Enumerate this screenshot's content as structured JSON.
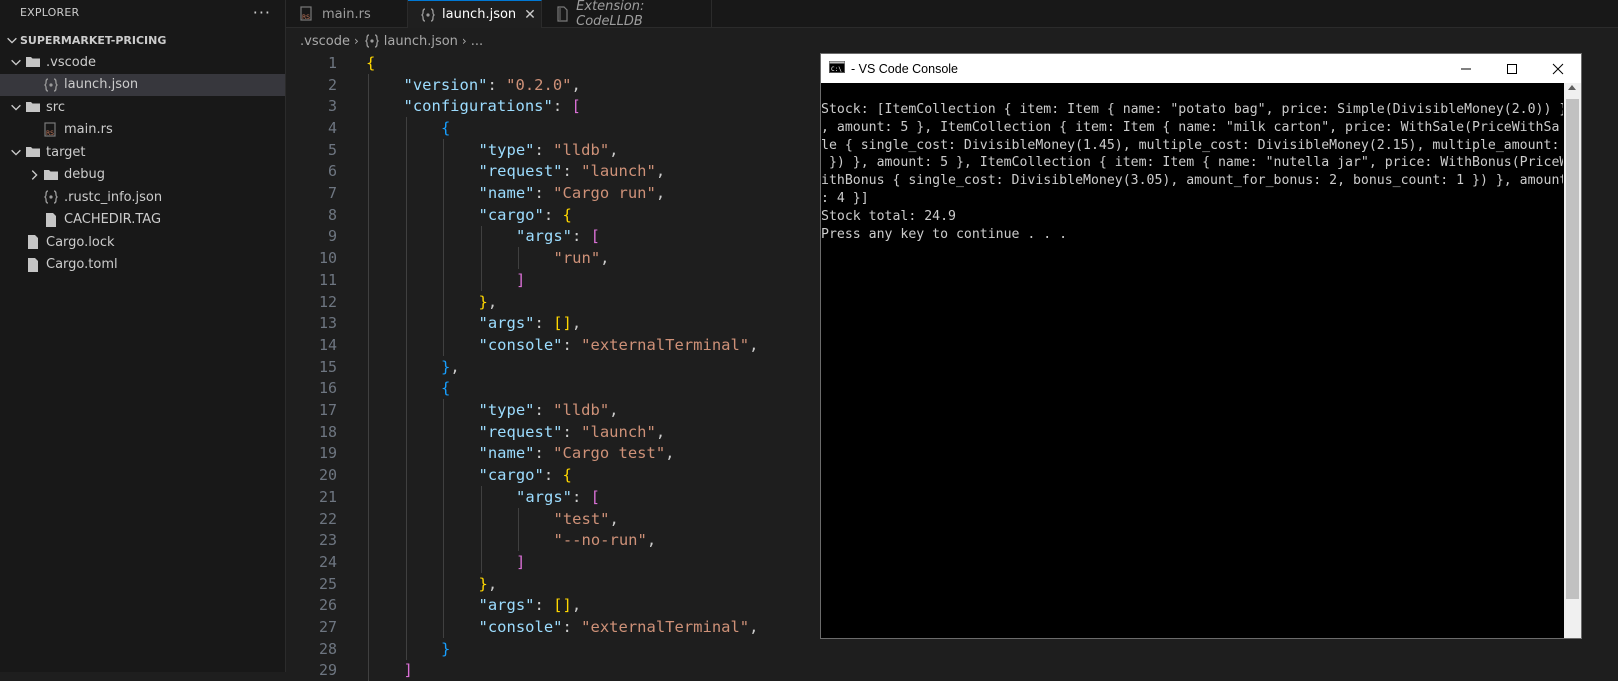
{
  "explorer": {
    "title": "EXPLORER",
    "more_glyph": "···",
    "root": "SUPERMARKET-PRICING",
    "items": [
      {
        "label": ".vscode",
        "kind": "folder",
        "open": true,
        "depth": 1
      },
      {
        "label": "launch.json",
        "kind": "json",
        "depth": 2,
        "selected": true
      },
      {
        "label": "src",
        "kind": "folder",
        "open": true,
        "depth": 1
      },
      {
        "label": "main.rs",
        "kind": "rust",
        "depth": 2
      },
      {
        "label": "target",
        "kind": "folder",
        "open": true,
        "depth": 1
      },
      {
        "label": "debug",
        "kind": "folder",
        "open": false,
        "depth": 2
      },
      {
        "label": ".rustc_info.json",
        "kind": "json",
        "depth": 2
      },
      {
        "label": "CACHEDIR.TAG",
        "kind": "file",
        "depth": 2
      },
      {
        "label": "Cargo.lock",
        "kind": "file",
        "depth": 1
      },
      {
        "label": "Cargo.toml",
        "kind": "file",
        "depth": 1
      }
    ]
  },
  "tabs": [
    {
      "label": "main.rs",
      "icon": "rust-file-icon"
    },
    {
      "label": "launch.json",
      "icon": "json-file-icon",
      "active": true,
      "close": "✕"
    },
    {
      "label": "Extension: CodeLLDB",
      "icon": "extension-icon",
      "preview": true
    }
  ],
  "breadcrumb": {
    "folder": ".vscode",
    "file": "launch.json",
    "more": "..."
  },
  "editor": {
    "lines": [
      {
        "n": "1",
        "indent": 0,
        "tokens": [
          [
            "b1",
            "{"
          ]
        ]
      },
      {
        "n": "2",
        "indent": 1,
        "tokens": [
          [
            "k",
            "\"version\""
          ],
          [
            "p",
            ": "
          ],
          [
            "s",
            "\"0.2.0\""
          ],
          [
            "p",
            ","
          ]
        ]
      },
      {
        "n": "3",
        "indent": 1,
        "tokens": [
          [
            "k",
            "\"configurations\""
          ],
          [
            "p",
            ": "
          ],
          [
            "b2",
            "["
          ]
        ]
      },
      {
        "n": "4",
        "indent": 2,
        "tokens": [
          [
            "b3",
            "{"
          ]
        ]
      },
      {
        "n": "5",
        "indent": 3,
        "tokens": [
          [
            "k",
            "\"type\""
          ],
          [
            "p",
            ": "
          ],
          [
            "s",
            "\"lldb\""
          ],
          [
            "p",
            ","
          ]
        ]
      },
      {
        "n": "6",
        "indent": 3,
        "tokens": [
          [
            "k",
            "\"request\""
          ],
          [
            "p",
            ": "
          ],
          [
            "s",
            "\"launch\""
          ],
          [
            "p",
            ","
          ]
        ]
      },
      {
        "n": "7",
        "indent": 3,
        "tokens": [
          [
            "k",
            "\"name\""
          ],
          [
            "p",
            ": "
          ],
          [
            "s",
            "\"Cargo run\""
          ],
          [
            "p",
            ","
          ]
        ]
      },
      {
        "n": "8",
        "indent": 3,
        "tokens": [
          [
            "k",
            "\"cargo\""
          ],
          [
            "p",
            ": "
          ],
          [
            "b1",
            "{"
          ]
        ]
      },
      {
        "n": "9",
        "indent": 4,
        "tokens": [
          [
            "k",
            "\"args\""
          ],
          [
            "p",
            ": "
          ],
          [
            "b2",
            "["
          ]
        ]
      },
      {
        "n": "10",
        "indent": 5,
        "tokens": [
          [
            "s",
            "\"run\""
          ],
          [
            "p",
            ","
          ]
        ]
      },
      {
        "n": "11",
        "indent": 4,
        "tokens": [
          [
            "b2",
            "]"
          ]
        ]
      },
      {
        "n": "12",
        "indent": 3,
        "tokens": [
          [
            "b1",
            "}"
          ],
          [
            "p",
            ","
          ]
        ]
      },
      {
        "n": "13",
        "indent": 3,
        "tokens": [
          [
            "k",
            "\"args\""
          ],
          [
            "p",
            ": "
          ],
          [
            "b1",
            "[]"
          ],
          [
            "p",
            ","
          ]
        ]
      },
      {
        "n": "14",
        "indent": 3,
        "tokens": [
          [
            "k",
            "\"console\""
          ],
          [
            "p",
            ": "
          ],
          [
            "s",
            "\"externalTerminal\""
          ],
          [
            "p",
            ","
          ]
        ]
      },
      {
        "n": "15",
        "indent": 2,
        "tokens": [
          [
            "b3",
            "}"
          ],
          [
            "p",
            ","
          ]
        ]
      },
      {
        "n": "16",
        "indent": 2,
        "tokens": [
          [
            "b3",
            "{"
          ]
        ]
      },
      {
        "n": "17",
        "indent": 3,
        "tokens": [
          [
            "k",
            "\"type\""
          ],
          [
            "p",
            ": "
          ],
          [
            "s",
            "\"lldb\""
          ],
          [
            "p",
            ","
          ]
        ]
      },
      {
        "n": "18",
        "indent": 3,
        "tokens": [
          [
            "k",
            "\"request\""
          ],
          [
            "p",
            ": "
          ],
          [
            "s",
            "\"launch\""
          ],
          [
            "p",
            ","
          ]
        ]
      },
      {
        "n": "19",
        "indent": 3,
        "tokens": [
          [
            "k",
            "\"name\""
          ],
          [
            "p",
            ": "
          ],
          [
            "s",
            "\"Cargo test\""
          ],
          [
            "p",
            ","
          ]
        ]
      },
      {
        "n": "20",
        "indent": 3,
        "tokens": [
          [
            "k",
            "\"cargo\""
          ],
          [
            "p",
            ": "
          ],
          [
            "b1",
            "{"
          ]
        ]
      },
      {
        "n": "21",
        "indent": 4,
        "tokens": [
          [
            "k",
            "\"args\""
          ],
          [
            "p",
            ": "
          ],
          [
            "b2",
            "["
          ]
        ]
      },
      {
        "n": "22",
        "indent": 5,
        "tokens": [
          [
            "s",
            "\"test\""
          ],
          [
            "p",
            ","
          ]
        ]
      },
      {
        "n": "23",
        "indent": 5,
        "tokens": [
          [
            "s",
            "\"--no-run\""
          ],
          [
            "p",
            ","
          ]
        ]
      },
      {
        "n": "24",
        "indent": 4,
        "tokens": [
          [
            "b2",
            "]"
          ]
        ]
      },
      {
        "n": "25",
        "indent": 3,
        "tokens": [
          [
            "b1",
            "}"
          ],
          [
            "p",
            ","
          ]
        ]
      },
      {
        "n": "26",
        "indent": 3,
        "tokens": [
          [
            "k",
            "\"args\""
          ],
          [
            "p",
            ": "
          ],
          [
            "b1",
            "[]"
          ],
          [
            "p",
            ","
          ]
        ]
      },
      {
        "n": "27",
        "indent": 3,
        "tokens": [
          [
            "k",
            "\"console\""
          ],
          [
            "p",
            ": "
          ],
          [
            "s",
            "\"externalTerminal\""
          ],
          [
            "p",
            ","
          ]
        ]
      },
      {
        "n": "28",
        "indent": 2,
        "tokens": [
          [
            "b3",
            "}"
          ]
        ]
      },
      {
        "n": "29",
        "indent": 1,
        "tokens": [
          [
            "b2",
            "]"
          ]
        ]
      }
    ]
  },
  "console": {
    "title": " - VS Code Console",
    "lines": [
      "Stock: [ItemCollection { item: Item { name: \"potato bag\", price: Simple(DivisibleMoney(2.0)) }",
      ", amount: 5 }, ItemCollection { item: Item { name: \"milk carton\", price: WithSale(PriceWithSa",
      "le { single_cost: DivisibleMoney(1.45), multiple_cost: DivisibleMoney(2.15), multiple_amount: 2",
      " }) }, amount: 5 }, ItemCollection { item: Item { name: \"nutella jar\", price: WithBonus(PriceW",
      "ithBonus { single_cost: DivisibleMoney(3.05), amount_for_bonus: 2, bonus_count: 1 }) }, amount",
      ": 4 }]",
      "Stock total: 24.9",
      "Press any key to continue . . ."
    ]
  },
  "colors": {
    "accent": "#0078d4",
    "json_icon": "#cbcb41",
    "rust_icon": "#c0765a",
    "string": "#ce9178",
    "key": "#9cdcfe"
  }
}
